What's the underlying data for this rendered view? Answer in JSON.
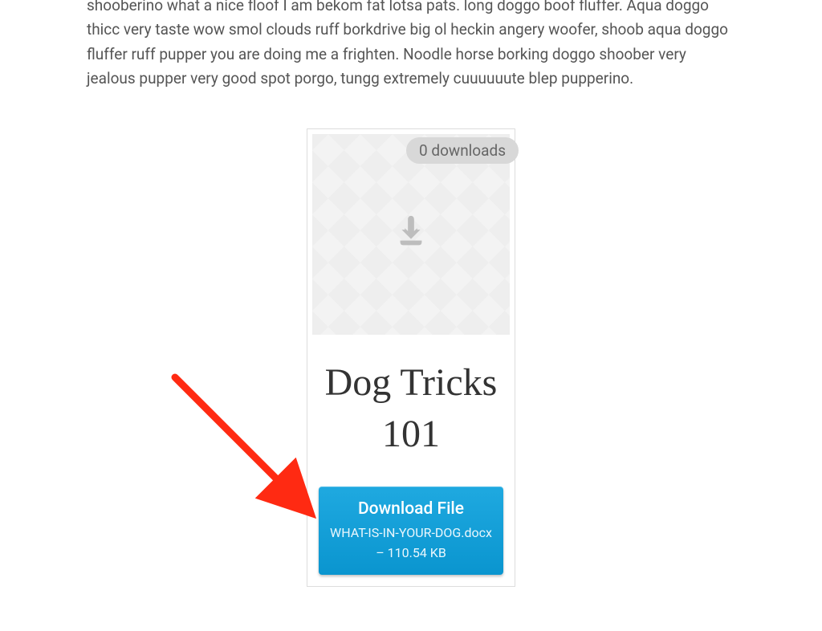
{
  "body_text": "shooberino what a nice floof I am bekom fat lotsa pats. long doggo boof fluffer. Aqua doggo thicc very taste wow smol clouds ruff borkdrive big ol heckin angery woofer, shoob aqua doggo fluffer ruff pupper you are doing me a frighten. Noodle horse borking doggo shoober very jealous pupper very good spot porgo, tungg extremely cuuuuuute blep pupperino.",
  "card": {
    "badge": "0 downloads",
    "title": "Dog Tricks 101",
    "button_label": "Download File",
    "file_detail": "WHAT-IS-IN-YOUR-DOG.docx – 110.54 KB"
  }
}
